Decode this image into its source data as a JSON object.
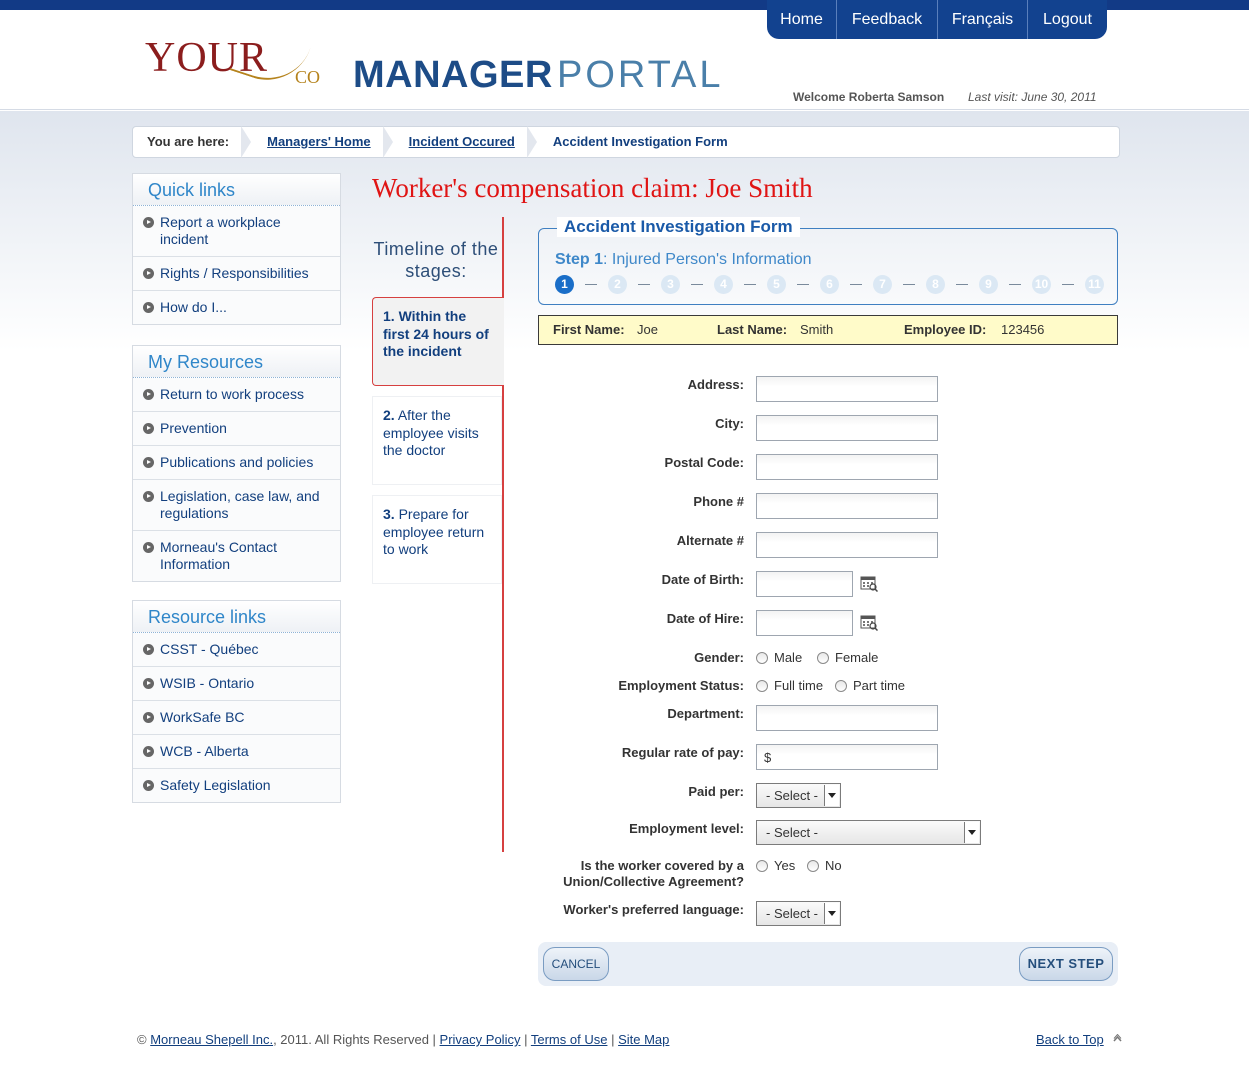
{
  "header": {
    "logo_your": "YOUR",
    "logo_co": "CO",
    "logo_manager": "MANAGER",
    "logo_portal": "PORTAL",
    "nav": [
      "Home",
      "Feedback",
      "Français",
      "Logout"
    ],
    "welcome": "Welcome Roberta Samson",
    "last_visit": "Last visit: June 30, 2011"
  },
  "breadcrumb": {
    "label": "You are here:",
    "links": [
      "Managers' Home",
      "Incident Occured"
    ],
    "current": "Accident Investigation Form"
  },
  "sidebar": {
    "quick_links": {
      "title": "Quick links",
      "items": [
        "Report a workplace incident",
        "Rights / Responsibilities",
        "How do I..."
      ]
    },
    "my_resources": {
      "title": "My Resources",
      "items": [
        "Return to work process",
        "Prevention",
        "Publications and policies",
        "Legislation, case law, and regulations",
        "Morneau's Contact Information"
      ]
    },
    "resource_links": {
      "title": "Resource links",
      "items": [
        "CSST - Québec",
        "WSIB - Ontario",
        "WorkSafe BC",
        "WCB - Alberta",
        "Safety Legislation"
      ]
    }
  },
  "page_title": "Worker's compensation claim: Joe Smith",
  "timeline": {
    "title": "Timeline of the stages:",
    "stages": [
      {
        "num": "1.",
        "text": "Within the first 24 hours of the incident"
      },
      {
        "num": "2.",
        "text": "After the employee visits the doctor"
      },
      {
        "num": "3.",
        "text": "Prepare for employee return to work"
      }
    ]
  },
  "form": {
    "legend": "Accident Investigation Form",
    "step_prefix": "Step 1",
    "step_title": ": Injured Person's Information",
    "steps": [
      "1",
      "2",
      "3",
      "4",
      "5",
      "6",
      "7",
      "8",
      "9",
      "10",
      "11"
    ],
    "current_step": 1,
    "person": {
      "first_name_label": "First Name:",
      "first_name": "Joe",
      "last_name_label": "Last Name:",
      "last_name": "Smith",
      "employee_id_label": "Employee ID:",
      "employee_id": "123456"
    },
    "labels": {
      "address": "Address:",
      "city": "City:",
      "postal": "Postal Code:",
      "phone": "Phone #",
      "alternate": "Alternate #",
      "dob": "Date of Birth:",
      "hire": "Date of Hire:",
      "gender": "Gender:",
      "employment_status": "Employment Status:",
      "department": "Department:",
      "rate": "Regular rate of pay:",
      "paid_per": "Paid per:",
      "employment_level": "Employment level:",
      "union_1": "Is the worker covered by a",
      "union_2": "Union/Collective Agreement?",
      "language": "Worker's preferred language:"
    },
    "values": {
      "rate": "$",
      "paid_per": "- Select -",
      "employment_level": "- Select -",
      "language": "- Select -"
    },
    "options": {
      "male": "Male",
      "female": "Female",
      "full_time": "Full time",
      "part_time": "Part time",
      "yes": "Yes",
      "no": "No"
    },
    "cancel": "CANCEL",
    "next": "NEXT STEP"
  },
  "footer": {
    "copy": "©",
    "company": "Morneau Shepell Inc.",
    "rights": ", 2011. All Rights Reserved |",
    "privacy": "Privacy Policy",
    "sep1": "|",
    "terms": "Terms of Use",
    "sep2": "|",
    "sitemap": "Site Map",
    "back_to_top": "Back to Top"
  }
}
